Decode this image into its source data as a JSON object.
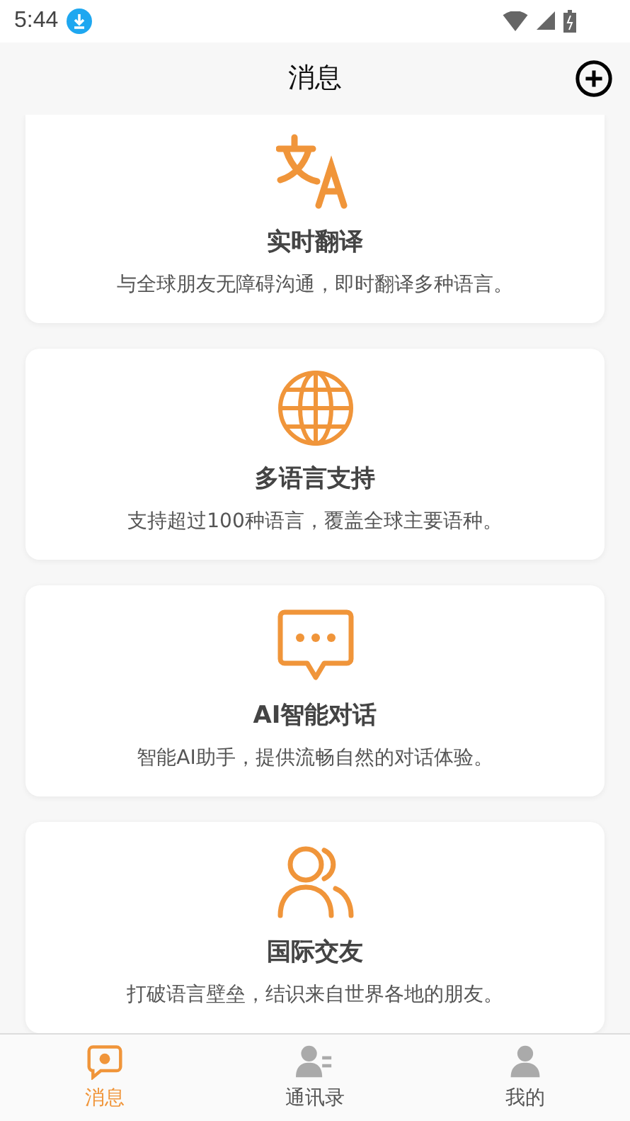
{
  "status_bar": {
    "time": "5:44"
  },
  "header": {
    "title": "消息"
  },
  "features": [
    {
      "kind": "translate",
      "title": "实时翻译",
      "description": "与全球朋友无障碍沟通，即时翻译多种语言。"
    },
    {
      "kind": "globe",
      "title": "多语言支持",
      "description": "支持超过100种语言，覆盖全球主要语种。"
    },
    {
      "kind": "chat",
      "title": "AI智能对话",
      "description": "智能AI助手，提供流畅自然的对话体验。"
    },
    {
      "kind": "people",
      "title": "国际交友",
      "description": "打破语言壁垒，结识来自世界各地的朋友。"
    }
  ],
  "tabs": [
    {
      "kind": "chat",
      "label": "消息",
      "selected": true
    },
    {
      "kind": "contacts",
      "label": "通讯录",
      "selected": false
    },
    {
      "kind": "person",
      "label": "我的",
      "selected": false
    }
  ]
}
